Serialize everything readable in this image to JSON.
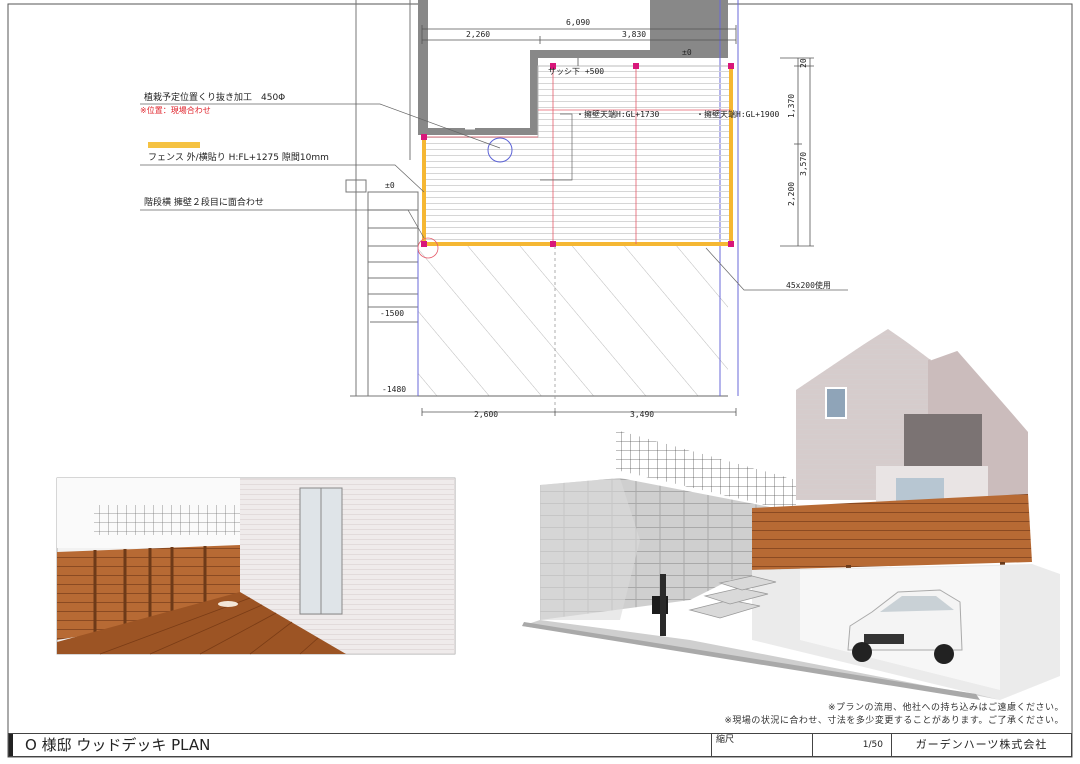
{
  "plan": {
    "dim_total": "6,090",
    "dim_left_top": "2,260",
    "dim_right_top": "3,830",
    "dim_bottom_left": "2,600",
    "dim_bottom_right": "3,490",
    "dim_v_top": "20",
    "dim_v_mid": "1,370",
    "dim_v_total": "3,570",
    "dim_v_low": "2,200",
    "level_zero_top": "±0",
    "level_zero_left": "±0",
    "level_m1500": "-1500",
    "level_m1480": "-1480",
    "sash_label": "サッシ下 +500",
    "wall_top1": "・擁壁天端H:GL+1730",
    "wall_top2": "・擁壁天端H:GL+1900",
    "lumber_label": "45x200使用"
  },
  "callouts": {
    "planting_title": "植栽予定位置くり抜き加工　450Φ",
    "planting_note": "※位置：現場合わせ",
    "fence_label": "フェンス 外/横貼り H:FL+1275 隙間10mm",
    "stair_label": "階段横 擁壁２段目に面合わせ",
    "fence_color": "#f5c242",
    "note_color": "#e0242c"
  },
  "notes": {
    "line1": "※プランの流用、他社への持ち込みはご遠慮ください。",
    "line2": "※現場の状況に合わせ、寸法を多少変更することがあります。ご了承ください。"
  },
  "title_block": {
    "title": "O 様邸 ウッドデッキ PLAN",
    "scale_label": "縮尺",
    "scale_value": "1/50",
    "company": "ガーデンハーツ株式会社"
  }
}
